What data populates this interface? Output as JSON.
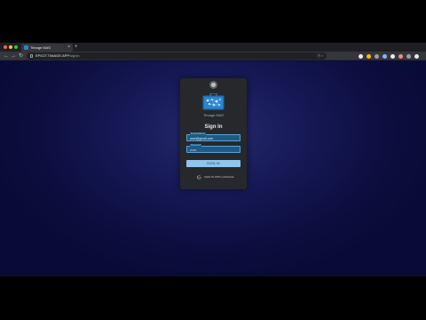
{
  "browser": {
    "tab": {
      "title": "Timage MAS",
      "close": "×"
    },
    "new_tab": "+",
    "nav": {
      "back": "←",
      "forward": "→",
      "reload": "↻"
    },
    "omnibox": {
      "url_host": "EPICIT.TIMAGE.APP",
      "url_path": "/signin",
      "right_text": "Ⓐ☆"
    },
    "extension_colors": [
      "#e8eaed",
      "#fbbc04",
      "#9aa0a6",
      "#8ab4f8",
      "#e8eaed",
      "#f28b82",
      "#9aa0a6",
      "#e8eaed"
    ]
  },
  "login": {
    "brand": "Timage MAS",
    "heading": "Sign In",
    "email": {
      "label": "Email Address",
      "value": "user@gmail.com"
    },
    "password": {
      "label": "Password",
      "value": "••••••"
    },
    "signin_button": "SIGN IN",
    "google_label": "SIGN IN WITH GOOGLE"
  },
  "colors": {
    "page_bg": "#0b0d3d",
    "card_bg": "#27282b",
    "accent": "#8ec4ee",
    "field_bg": "#1f5a85"
  }
}
